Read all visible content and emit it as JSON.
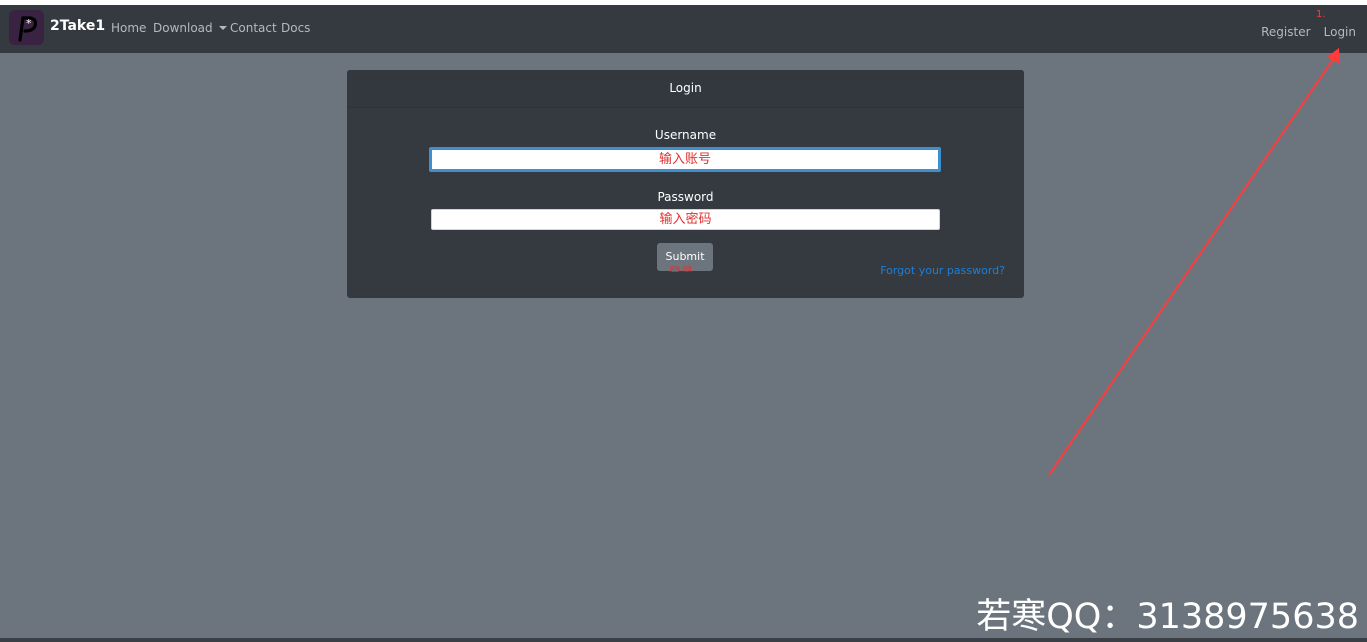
{
  "navbar": {
    "brand": "2Take1",
    "links": [
      "Home",
      "Download",
      "Contact",
      "Docs"
    ],
    "right": {
      "register": "Register",
      "login": "Login"
    },
    "annotation": "1."
  },
  "login_card": {
    "title": "Login",
    "username": {
      "label": "Username",
      "value": "输入账号"
    },
    "password": {
      "label": "Password",
      "value": "输入密码"
    },
    "submit": "Submit",
    "submit_annotation": "登录",
    "forgot": "Forgot your password?"
  },
  "watermark": "若寒QQ：3138975638",
  "colors": {
    "background": "#6c757d",
    "navbar": "#343a40",
    "card": "#343a40",
    "annotation": "#ff3b3b",
    "link": "#1e7fd6",
    "focus_border": "#3d8fcf"
  }
}
